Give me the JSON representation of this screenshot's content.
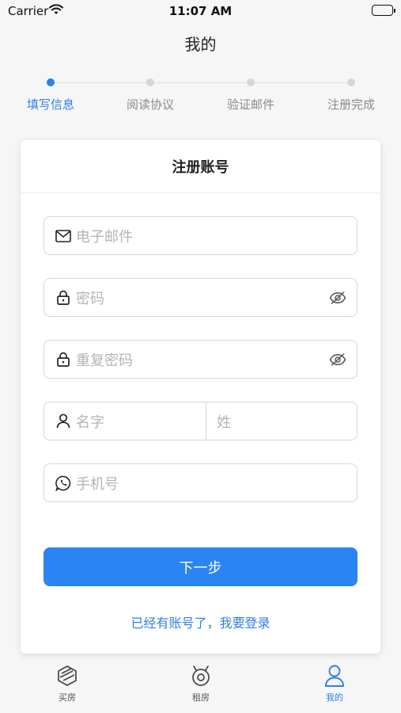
{
  "status_bar": {
    "carrier": "Carrier",
    "time": "11:07 AM"
  },
  "nav": {
    "title": "我的"
  },
  "stepper": {
    "steps": [
      {
        "label": "填写信息",
        "active": true
      },
      {
        "label": "阅读协议",
        "active": false
      },
      {
        "label": "验证邮件",
        "active": false
      },
      {
        "label": "注册完成",
        "active": false
      }
    ]
  },
  "form": {
    "title": "注册账号",
    "email_placeholder": "电子邮件",
    "password_placeholder": "密码",
    "repeat_password_placeholder": "重复密码",
    "first_name_placeholder": "名字",
    "last_name_placeholder": "姓",
    "phone_placeholder": "手机号",
    "next_label": "下一步",
    "login_link": "已经有账号了，我要登录"
  },
  "tabbar": {
    "items": [
      {
        "label": "买房",
        "icon": "cube-icon",
        "active": false
      },
      {
        "label": "租房",
        "icon": "house-rent-icon",
        "active": false
      },
      {
        "label": "我的",
        "icon": "user-icon",
        "active": true
      }
    ]
  },
  "colors": {
    "accent": "#2a84f4",
    "step_active": "#2f7fe6",
    "placeholder": "#b4b4b4"
  }
}
